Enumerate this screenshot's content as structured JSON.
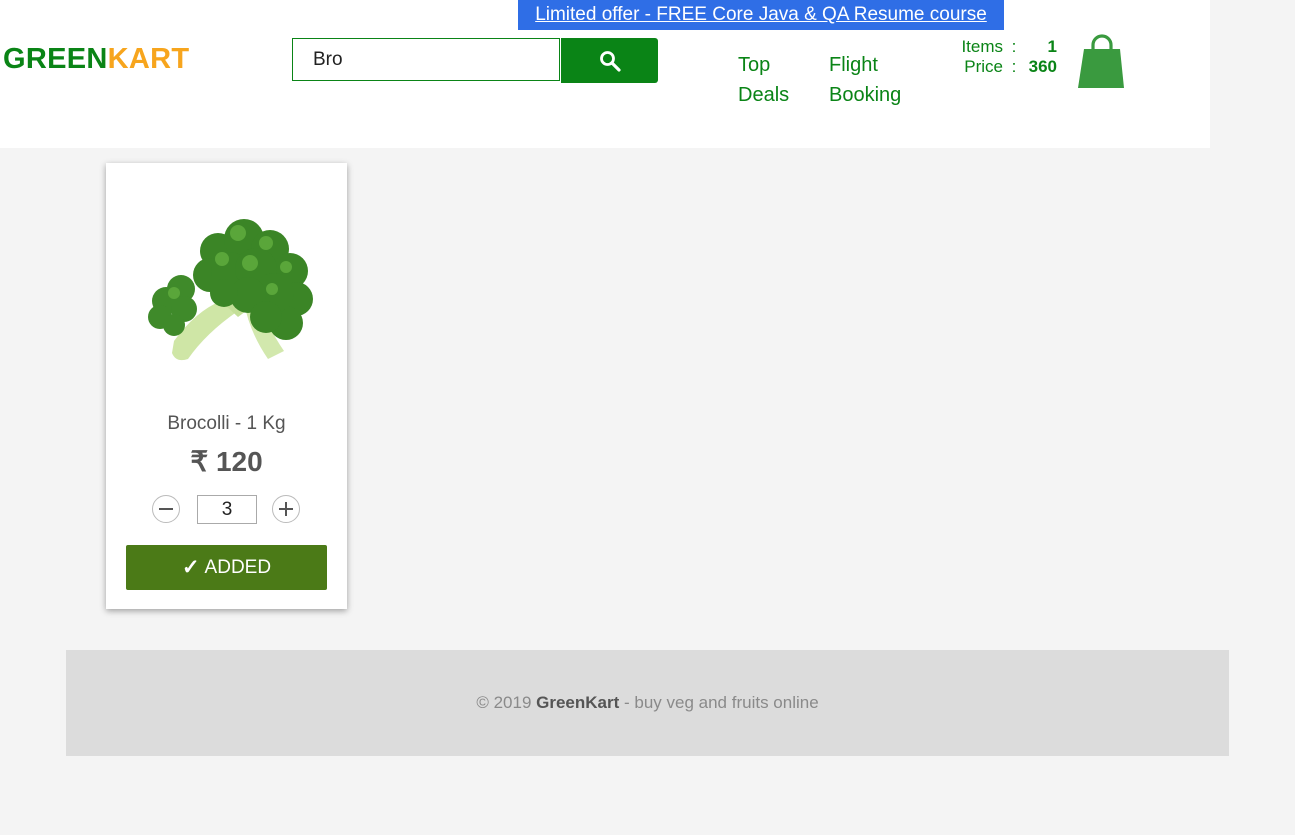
{
  "banner": {
    "text": "Limited offer - FREE Core Java & QA Resume course"
  },
  "brand": {
    "part1": "GREEN",
    "part2": "KART"
  },
  "search": {
    "value": "Bro",
    "icon": "search-icon"
  },
  "nav": {
    "top_deals_line1": "Top",
    "top_deals_line2": "Deals",
    "flight_booking_line1": "Flight",
    "flight_booking_line2": "Booking"
  },
  "cart": {
    "items_label": "Items",
    "items_value": "1",
    "price_label": "Price",
    "price_value": "360",
    "separator": ":",
    "icon": "shopping-bag-icon"
  },
  "product": {
    "name": "Brocolli - 1 Kg",
    "currency": "₹",
    "price": "120",
    "quantity": "3",
    "button_tick": "✓",
    "button_label": "ADDED",
    "image": "broccoli-image"
  },
  "footer": {
    "prefix": "© 2019 ",
    "brand": "GreenKart",
    "suffix": " - buy veg and fruits online"
  },
  "colors": {
    "brand_green": "#0a8416",
    "brand_orange": "#f7a51d",
    "banner_blue": "#2f6ee6",
    "added_button": "#4b7a17",
    "cart_bag": "#3a9a3f",
    "page_background": "#f4f4f4",
    "footer_background": "#dcdcdc"
  }
}
